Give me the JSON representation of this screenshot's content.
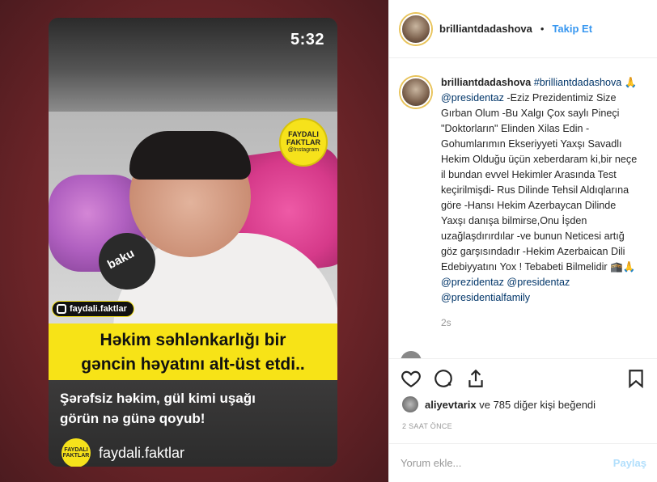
{
  "video": {
    "time": "5:32",
    "mic_label": "baku",
    "badge_line1": "FAYDALI",
    "badge_line2": "FAKTLAR",
    "badge_line3": "@Instagram",
    "handle": "faydali.faktlar",
    "headline_line1": "Həkim səhlənkarlığı bir",
    "headline_line2": "gəncin həyatını alt-üst etdi..",
    "subtitle_line1": "Şərəfsiz həkim, gül kimi uşağı",
    "subtitle_line2": "görün nə günə qoyub!",
    "bottom_logo": "FAYDALI FAKTLAR",
    "bottom_name": "faydali.faktlar"
  },
  "header": {
    "username": "brilliantdadashova",
    "separator": "•",
    "follow_label": "Takip Et"
  },
  "caption": {
    "username": "brilliantdadashova",
    "hashtag": "#brilliantdadashova",
    "emoji_pray": "🙏",
    "mention1": "@presidentaz",
    "body": "-Eziz Prezidentimiz Size Gırban Olum -Bu Xalgı Çox saylı Pineçi \"Doktorların\" Elinden Xilas Edin -Gohumlarımın Ekseriyyeti Yaxşı Savadlı Hekim Olduğu üçün xeberdaram ki,bir neçe il bundan evvel Hekimler Arasında Test keçirilmişdi- Rus Dilinde Tehsil Aldıqlarına göre -Hansı Hekim Azerbaycan Dilinde Yaxşı danışa bilmirse,Onu İşden uzağlaşdırırdılar -ve bunun Neticesi artığ göz garşısındadır -Hekim Azerbaican Dili Edebiyyatını Yox ! Tebabeti Bilmelidir",
    "emoji_end": "🕋🙏",
    "mention2": "@prezidentaz",
    "mention3": "@presidentaz",
    "mention4": "@presidentialfamily",
    "time": "2s"
  },
  "actions": {
    "like_icon": "heart-icon",
    "comment_icon": "comment-icon",
    "share_icon": "share-icon",
    "save_icon": "bookmark-icon"
  },
  "likes": {
    "liker": "aliyevtarix",
    "rest": "ve 785 diğer kişi beğendi"
  },
  "ago": "2 SAAT ÖNCE",
  "comment": {
    "placeholder": "Yorum ekle...",
    "post_label": "Paylaş"
  },
  "colors": {
    "accent": "#3897f0",
    "headline_bg": "#f7e317",
    "post_disabled": "#b2dffc"
  }
}
